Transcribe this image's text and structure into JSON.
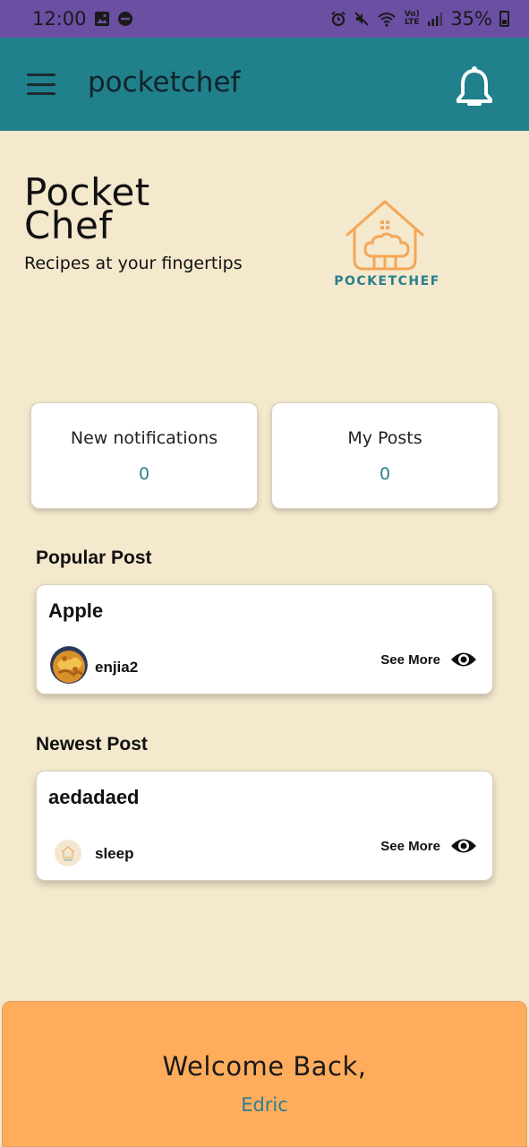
{
  "status_bar": {
    "time": "12:00",
    "battery_text": "35%",
    "icons": [
      "gallery-icon",
      "dnd-icon",
      "alarm-icon",
      "mute-icon",
      "wifi-icon",
      "volte-icon",
      "signal-icon",
      "battery-icon"
    ],
    "volte_text": "Vo) LTE"
  },
  "app_bar": {
    "title": "pocketchef",
    "menu_icon": "hamburger-menu-icon",
    "notification_icon": "bell-icon"
  },
  "hero": {
    "title_line1": "Pocket",
    "title_line2": "Chef",
    "subtitle": "Recipes at your fingertips",
    "logo_text": "POCKETCHEF"
  },
  "stats": {
    "notifications_label": "New notifications",
    "notifications_value": "0",
    "posts_label": "My Posts",
    "posts_value": "0"
  },
  "popular": {
    "section_title": "Popular Post",
    "post_title": "Apple",
    "author": "enjia2",
    "see_more": "See More"
  },
  "newest": {
    "section_title": "Newest Post",
    "post_title": "aedadaed",
    "author": "sleep",
    "see_more": "See More"
  },
  "welcome": {
    "greeting": "Welcome Back,",
    "name": "Edric"
  },
  "colors": {
    "status_bar": "#6A4FA3",
    "app_bar": "#20808C",
    "background": "#F4E8CD",
    "accent_teal": "#2A7F8D",
    "welcome_panel": "#FFAD5C",
    "logo_orange": "#F4A757"
  }
}
